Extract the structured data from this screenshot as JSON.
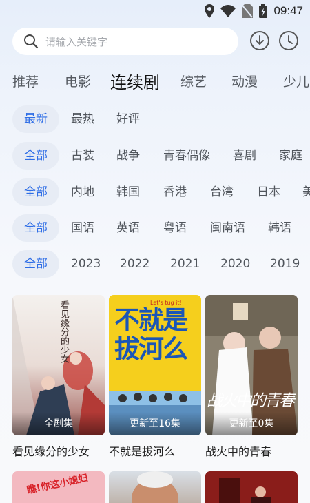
{
  "status": {
    "time": "09:47"
  },
  "search": {
    "placeholder": "请输入关键字"
  },
  "tabs": [
    {
      "label": "推荐"
    },
    {
      "label": "电影"
    },
    {
      "label": "连续剧"
    },
    {
      "label": "综艺"
    },
    {
      "label": "动漫"
    },
    {
      "label": "少儿"
    }
  ],
  "filters": {
    "sort": [
      "最新",
      "最热",
      "好评"
    ],
    "genre": [
      "全部",
      "古装",
      "战争",
      "青春偶像",
      "喜剧",
      "家庭"
    ],
    "region": [
      "全部",
      "内地",
      "韩国",
      "香港",
      "台湾",
      "日本",
      "美"
    ],
    "language": [
      "全部",
      "国语",
      "英语",
      "粤语",
      "闽南语",
      "韩语"
    ],
    "year": [
      "全部",
      "2023",
      "2022",
      "2021",
      "2020",
      "2019"
    ]
  },
  "cards": [
    {
      "title": "看见缘分的少女",
      "badge": "全剧集",
      "poster_text": "看见缘分的少女"
    },
    {
      "title": "不就是拔河么",
      "badge": "更新至16集",
      "poster_text": "不就是拔河么",
      "poster_tag": "Let's tug it!"
    },
    {
      "title": "战火中的青春",
      "badge": "更新至0集",
      "poster_text": "战火中的青春"
    }
  ],
  "bottom_cards": [
    {
      "poster_text": "瞧!你这小媳妇"
    }
  ],
  "colors": {
    "accent": "#2f6ee6",
    "chip_bg": "#e7ecf5"
  }
}
